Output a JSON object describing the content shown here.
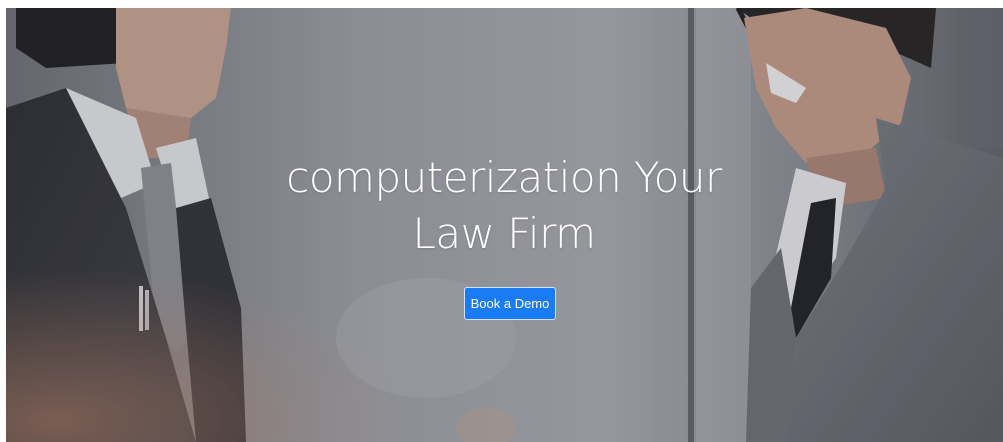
{
  "hero": {
    "title_line1": "computerization Your",
    "title_line2": "Law Firm",
    "cta_label": "Book a Demo",
    "background_image": "two-businessmen-shaking-hands-photo",
    "button_color": "#1a7cf5"
  }
}
